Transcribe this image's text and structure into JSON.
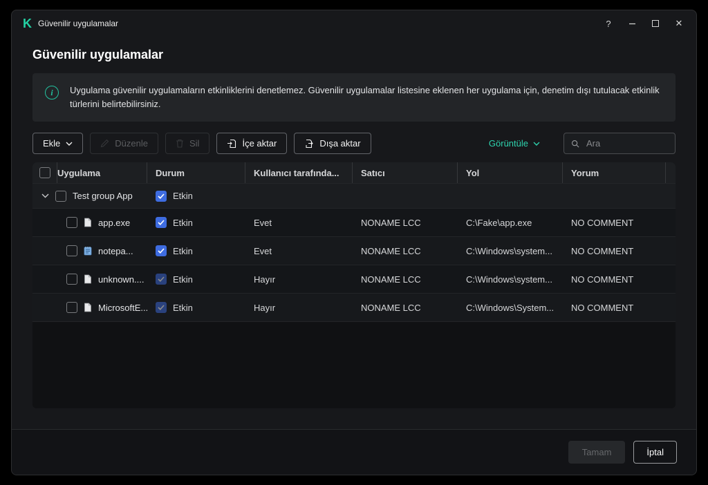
{
  "window": {
    "title": "Güvenilir uygulamalar",
    "controls": {
      "help": "?",
      "close": "✕"
    }
  },
  "page": {
    "title": "Güvenilir uygulamalar",
    "info_text": "Uygulama güvenilir uygulamaların etkinliklerini denetlemez. Güvenilir uygulamalar listesine eklenen her uygulama için, denetim dışı tutulacak etkinlik türlerini belirtebilirsiniz."
  },
  "toolbar": {
    "add_label": "Ekle",
    "edit_label": "Düzenle",
    "delete_label": "Sil",
    "import_label": "İçe aktar",
    "export_label": "Dışa aktar",
    "view_label": "Görüntüle",
    "search_placeholder": "Ara"
  },
  "table": {
    "columns": [
      "Uygulama",
      "Durum",
      "Kullanıcı tarafında...",
      "Satıcı",
      "Yol",
      "Yorum"
    ],
    "group_row": {
      "name": "Test group App",
      "status": "Etkin"
    },
    "rows": [
      {
        "name": "app.exe",
        "status": "Etkin",
        "user": "Evet",
        "vendor": "NONAME LCC",
        "path": "C:\\Fake\\app.exe",
        "comment": "NO COMMENT"
      },
      {
        "name": "notepa...",
        "status": "Etkin",
        "user": "Evet",
        "vendor": "NONAME LCC",
        "path": "C:\\Windows\\system...",
        "comment": "NO COMMENT"
      },
      {
        "name": "unknown....",
        "status": "Etkin",
        "user": "Hayır",
        "vendor": "NONAME LCC",
        "path": "C:\\Windows\\system...",
        "comment": "NO COMMENT"
      },
      {
        "name": "MicrosoftE...",
        "status": "Etkin",
        "user": "Hayır",
        "vendor": "NONAME LCC",
        "path": "C:\\Windows\\System...",
        "comment": "NO COMMENT"
      }
    ]
  },
  "footer": {
    "ok_label": "Tamam",
    "cancel_label": "İptal"
  },
  "colors": {
    "accent": "#23c3a0",
    "checkbox": "#3e6ce0"
  }
}
